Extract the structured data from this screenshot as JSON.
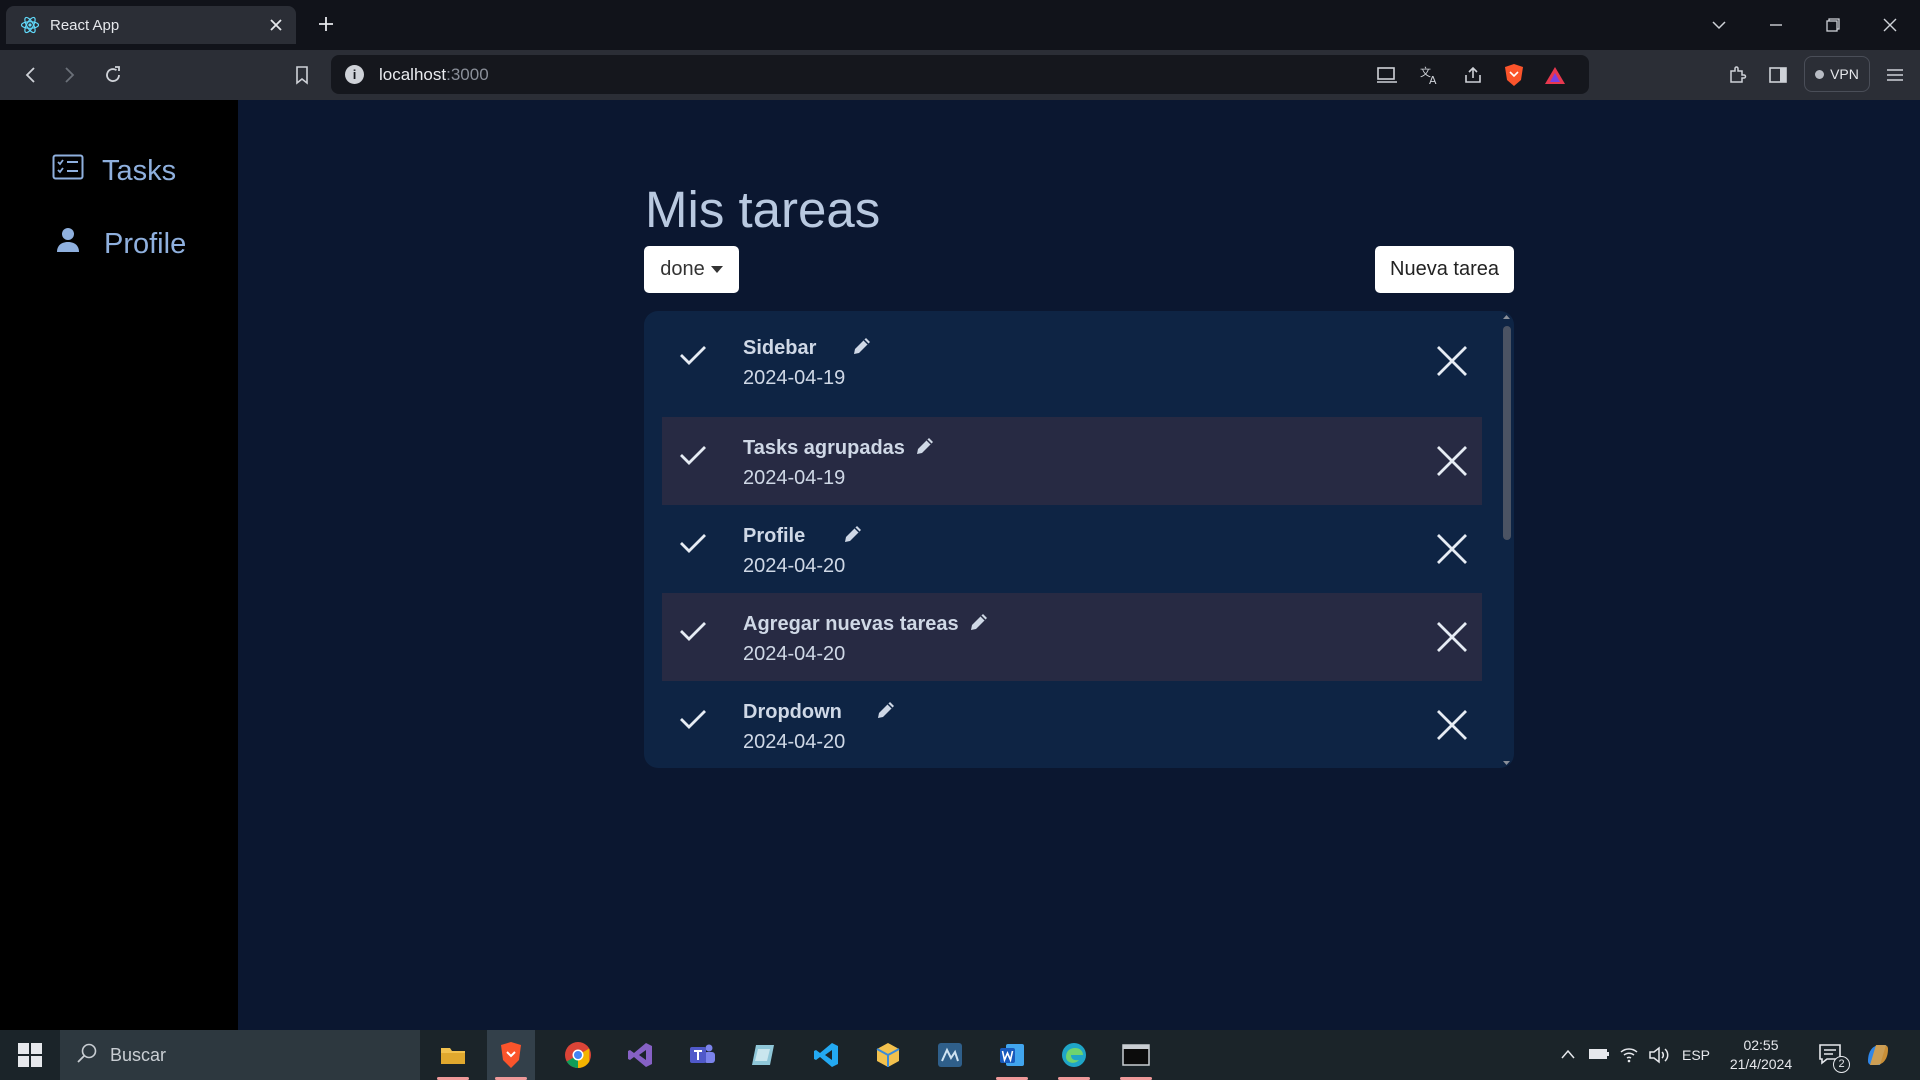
{
  "browser": {
    "tab_title": "React App",
    "url_host": "localhost",
    "url_port": ":3000",
    "vpn_label": "VPN"
  },
  "sidebar": {
    "items": [
      {
        "label": "Tasks",
        "icon": "task-list-icon"
      },
      {
        "label": "Profile",
        "icon": "person-icon"
      }
    ]
  },
  "main": {
    "title": "Mis tareas",
    "filter_label": "done",
    "new_task_label": "Nueva tarea",
    "tasks": [
      {
        "title": "Sidebar",
        "date": "2024-04-19"
      },
      {
        "title": "Tasks agrupadas",
        "date": "2024-04-19"
      },
      {
        "title": "Profile",
        "date": "2024-04-20"
      },
      {
        "title": "Agregar nuevas tareas",
        "date": "2024-04-20"
      },
      {
        "title": "Dropdown",
        "date": "2024-04-20"
      }
    ]
  },
  "taskbar": {
    "search_label": "Buscar",
    "language": "ESP",
    "time": "02:55",
    "date": "21/4/2024",
    "notification_count": "2"
  },
  "colors": {
    "page_bg": "#0b1730",
    "panel_bg": "#0e2444",
    "alt_row_bg": "#272a43",
    "sidebar_bg": "#000000",
    "sidebar_text": "#8fb0de"
  }
}
